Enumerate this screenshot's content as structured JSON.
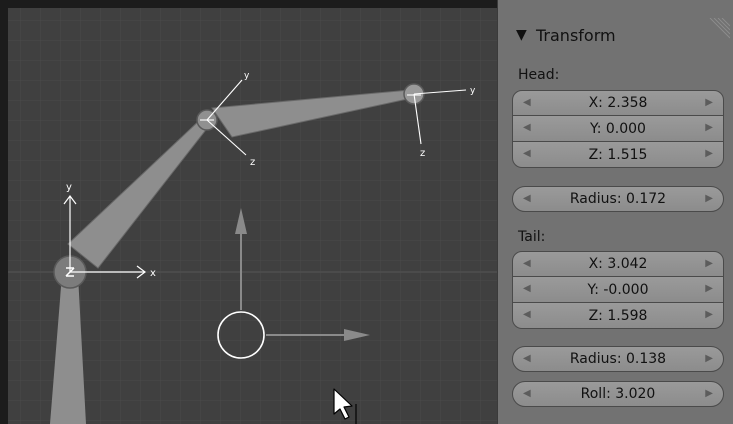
{
  "viewport": {
    "axis_labels": {
      "x": "x",
      "y": "y",
      "z": "z"
    }
  },
  "panel": {
    "title": "Transform",
    "head": {
      "label": "Head:",
      "x": "X: 2.358",
      "y": "Y: 0.000",
      "z": "Z: 1.515",
      "radius": "Radius: 0.172"
    },
    "tail": {
      "label": "Tail:",
      "x": "X: 3.042",
      "y": "Y: -0.000",
      "z": "Z: 1.598",
      "radius": "Radius: 0.138",
      "roll": "Roll: 3.020"
    }
  },
  "icons": [
    "collapse-triangle-icon",
    "panel-grip-icon",
    "decrement-arrow-icon",
    "increment-arrow-icon",
    "mouse-cursor-icon",
    "text-cursor-icon"
  ],
  "colors": {
    "viewport_bg": "#404040",
    "panel_bg": "#727272",
    "bone_fill": "#8e8e8e",
    "field_bg": "#9a9a9a"
  }
}
